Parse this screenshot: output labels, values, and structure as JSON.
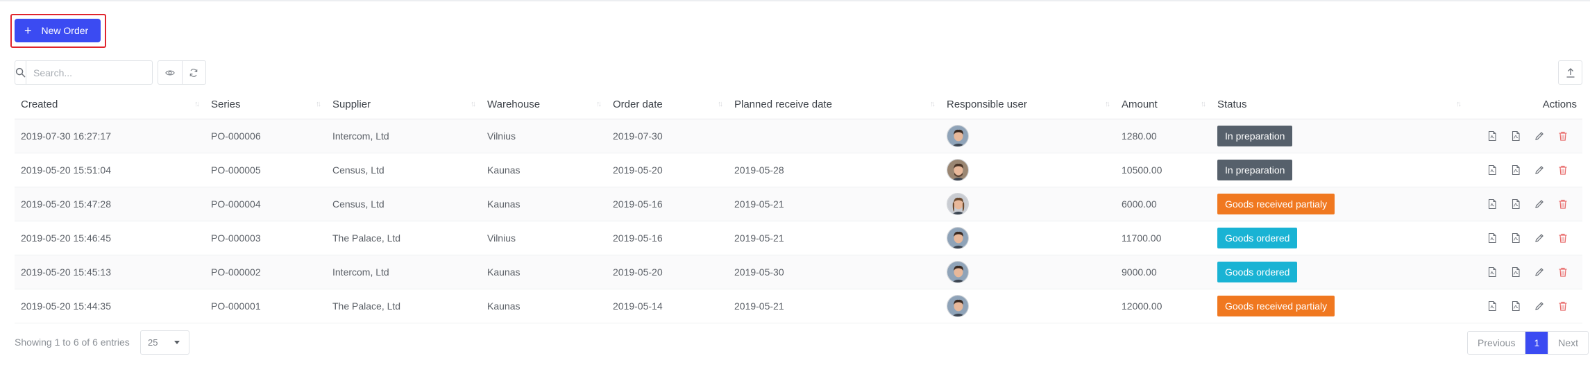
{
  "toolbar": {
    "new_order_label": "New Order",
    "search_placeholder": "Search..."
  },
  "colors": {
    "primary": "#3b4bf2",
    "highlight_border": "#e0242d",
    "status_in_preparation": "#56606b",
    "status_partial": "#f07820",
    "status_ordered": "#19b3d4",
    "delete_icon": "#e86a6a"
  },
  "table": {
    "columns": [
      "Created",
      "Series",
      "Supplier",
      "Warehouse",
      "Order date",
      "Planned receive date",
      "Responsible user",
      "Amount",
      "Status",
      "Actions"
    ],
    "rows": [
      {
        "created": "2019-07-30 16:27:17",
        "series": "PO-000006",
        "supplier": "Intercom, Ltd",
        "warehouse": "Vilnius",
        "order_date": "2019-07-30",
        "planned": "",
        "user_avatar": "man-dark-hair-avatar",
        "amount": "1280.00",
        "status": "In preparation",
        "status_color": "#56606b"
      },
      {
        "created": "2019-05-20 15:51:04",
        "series": "PO-000005",
        "supplier": "Census, Ltd",
        "warehouse": "Kaunas",
        "order_date": "2019-05-20",
        "planned": "2019-05-28",
        "user_avatar": "man-beard-avatar",
        "amount": "10500.00",
        "status": "In preparation",
        "status_color": "#56606b"
      },
      {
        "created": "2019-05-20 15:47:28",
        "series": "PO-000004",
        "supplier": "Census, Ltd",
        "warehouse": "Kaunas",
        "order_date": "2019-05-16",
        "planned": "2019-05-21",
        "user_avatar": "woman-avatar",
        "amount": "6000.00",
        "status": "Goods received partialy",
        "status_color": "#f07820"
      },
      {
        "created": "2019-05-20 15:46:45",
        "series": "PO-000003",
        "supplier": "The Palace, Ltd",
        "warehouse": "Vilnius",
        "order_date": "2019-05-16",
        "planned": "2019-05-21",
        "user_avatar": "man-dark-hair-avatar",
        "amount": "11700.00",
        "status": "Goods ordered",
        "status_color": "#19b3d4"
      },
      {
        "created": "2019-05-20 15:45:13",
        "series": "PO-000002",
        "supplier": "Intercom, Ltd",
        "warehouse": "Kaunas",
        "order_date": "2019-05-20",
        "planned": "2019-05-30",
        "user_avatar": "man-dark-hair-avatar",
        "amount": "9000.00",
        "status": "Goods ordered",
        "status_color": "#19b3d4"
      },
      {
        "created": "2019-05-20 15:44:35",
        "series": "PO-000001",
        "supplier": "The Palace, Ltd",
        "warehouse": "Kaunas",
        "order_date": "2019-05-14",
        "planned": "2019-05-21",
        "user_avatar": "man-dark-hair-avatar",
        "amount": "12000.00",
        "status": "Goods received partialy",
        "status_color": "#f07820"
      }
    ]
  },
  "footer": {
    "info": "Showing 1 to 6 of 6 entries",
    "page_length": "25",
    "previous": "Previous",
    "current_page": "1",
    "next": "Next"
  }
}
